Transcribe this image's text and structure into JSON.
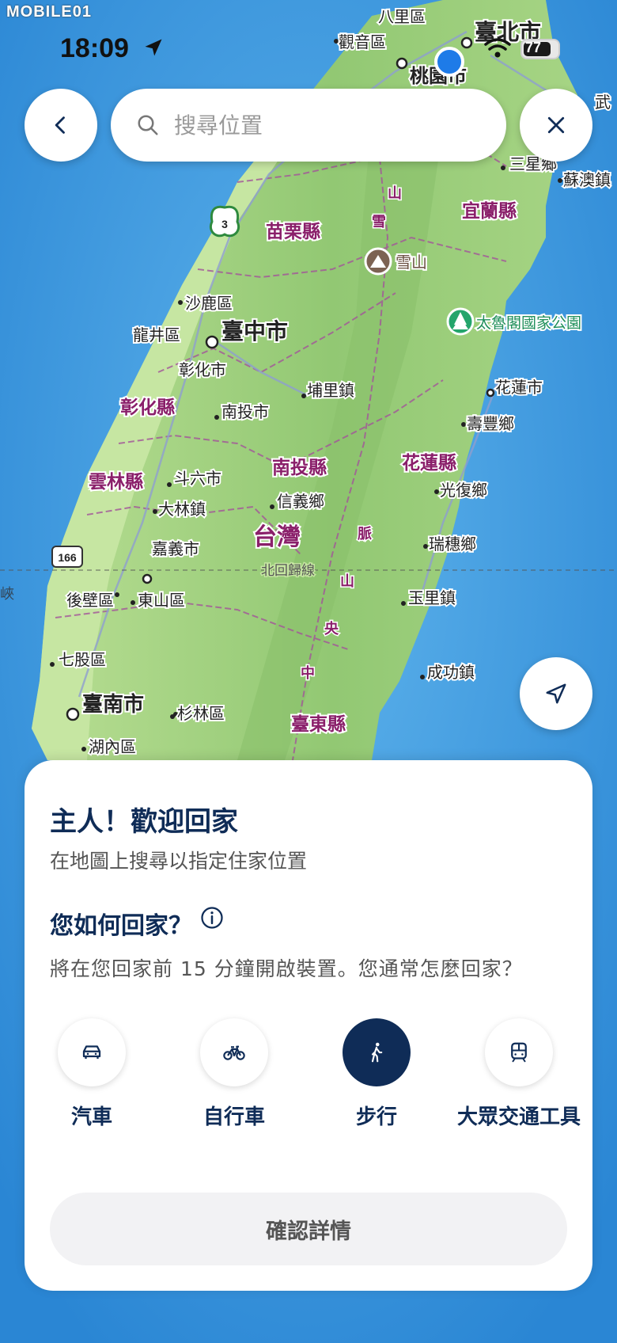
{
  "status_bar": {
    "watermark": "MOBILE01",
    "time": "18:09",
    "battery": "77"
  },
  "top_bar": {
    "back_icon": "chevron-left-icon",
    "search_placeholder": "搜尋位置",
    "close_icon": "close-icon"
  },
  "map": {
    "labels": {
      "bali": "八里區",
      "taipei": "臺北市",
      "guanyin": "觀音區",
      "taoyuan": "桃園市",
      "wu": "武",
      "sanxing": "三星鄉",
      "suao": "蘇澳鎮",
      "yilan_county": "宜蘭縣",
      "miaoli_county": "苗栗縣",
      "xueshan": "雪山",
      "shalu": "沙鹿區",
      "taroko": "太魯閣國家公園",
      "longjing": "龍井區",
      "taichung": "臺中市",
      "changhua": "彰化市",
      "puli": "埔里鎮",
      "hualien_city": "花蓮市",
      "changhua_county": "彰化縣",
      "nantou_city": "南投市",
      "shoufeng": "壽豐鄉",
      "yunlin_county": "雲林縣",
      "douliu": "斗六市",
      "nantou_county": "南投縣",
      "hualien_county": "花蓮縣",
      "xinyi": "信義鄉",
      "guangfu": "光復鄉",
      "dalin": "大林鎮",
      "taiwan": "台灣",
      "ruisui": "瑞穗鄉",
      "chiayi": "嘉義市",
      "tropic": "北回歸線",
      "houbi": "後壁區",
      "dongshan": "東山區",
      "yuli": "玉里鎮",
      "xia": "峽",
      "qigu": "七股區",
      "chenggong": "成功鎮",
      "tainan": "臺南市",
      "shanlin": "杉林區",
      "taitung_county": "臺東縣",
      "neimen": "湖內區",
      "road_3": "3",
      "road_166": "166",
      "central_range": [
        "中",
        "央",
        "山",
        "脈"
      ],
      "xueshan_range": [
        "雪",
        "山"
      ]
    },
    "recenter_icon": "navigation-arrow-icon"
  },
  "sheet": {
    "title": "主人！歡迎回家",
    "subtitle": "在地圖上搜尋以指定住家位置",
    "question": "您如何回家？",
    "description": "將在您回家前 15 分鐘開啟裝置。您通常怎麼回家？",
    "modes": [
      {
        "label": "汽車",
        "icon": "car-icon",
        "selected": false
      },
      {
        "label": "自行車",
        "icon": "bicycle-icon",
        "selected": false
      },
      {
        "label": "步行",
        "icon": "walking-icon",
        "selected": true
      },
      {
        "label": "大眾交通工具",
        "icon": "train-icon",
        "selected": false
      }
    ],
    "confirm_label": "確認詳情"
  },
  "colors": {
    "ocean": "#2f8fd8",
    "land": "#b4dc8e",
    "mountain": "#9fcf7e",
    "accent_navy": "#0f2c57",
    "county_label": "#8a1f6a",
    "border_line": "#a3559a"
  }
}
